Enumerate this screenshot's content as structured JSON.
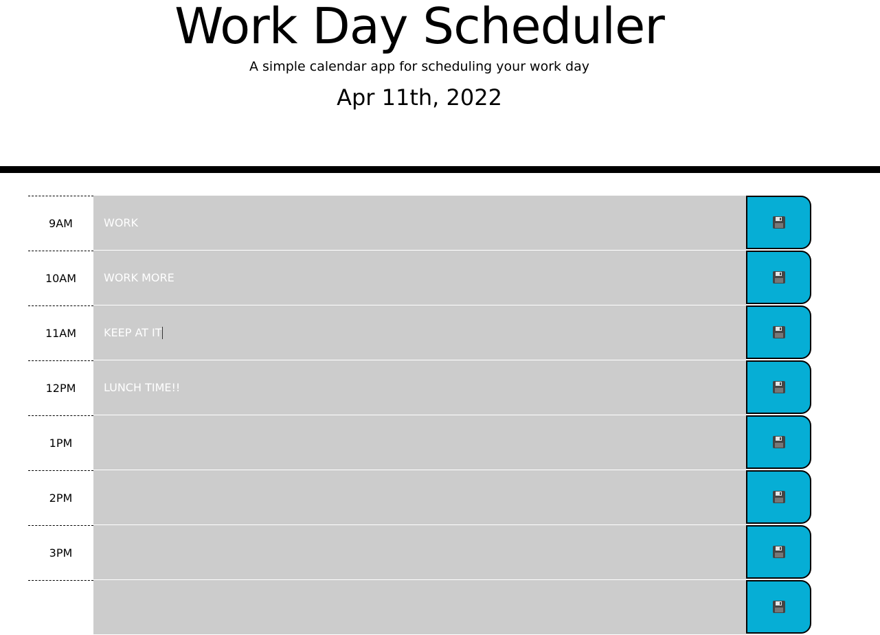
{
  "header": {
    "title": "Work Day Scheduler",
    "subtitle": "A simple calendar app for scheduling your work day",
    "current_day": "Apr 11th, 2022"
  },
  "colors": {
    "past_block": "#cccccc",
    "save_button": "#06aed5",
    "divider": "#000000"
  },
  "time_blocks": [
    {
      "hour": "9AM",
      "text": "WORK"
    },
    {
      "hour": "10AM",
      "text": "WORK MORE"
    },
    {
      "hour": "11AM",
      "text": "KEEP AT IT"
    },
    {
      "hour": "12PM",
      "text": "LUNCH TIME!!"
    },
    {
      "hour": "1PM",
      "text": ""
    },
    {
      "hour": "2PM",
      "text": ""
    },
    {
      "hour": "3PM",
      "text": ""
    },
    {
      "hour": "",
      "text": ""
    }
  ],
  "save_icon": "floppy-disk-icon"
}
